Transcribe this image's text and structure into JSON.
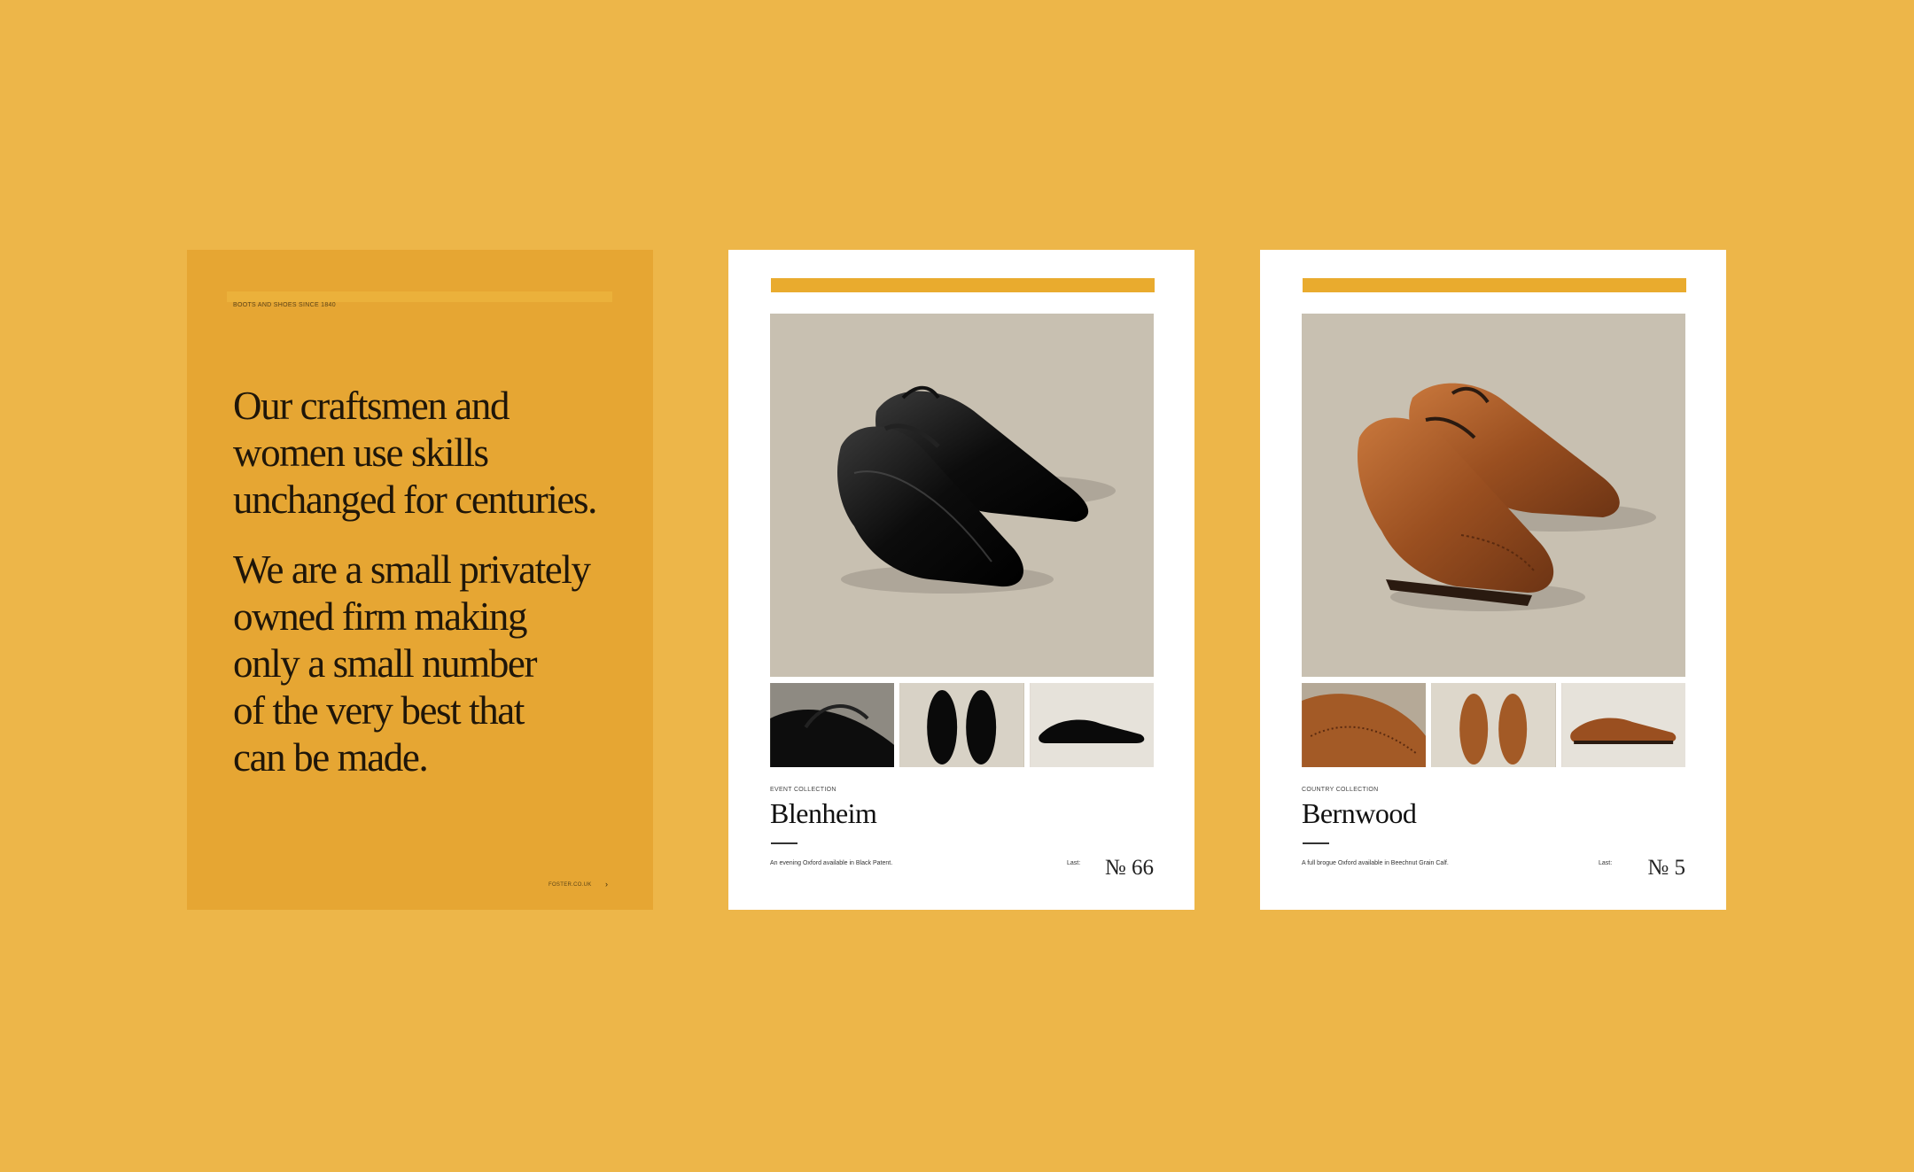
{
  "colors": {
    "background": "#EDB649",
    "intro_page": "#E6A633",
    "accent_bar": "#E9AB2E",
    "photo_backdrop": "#C8C0B1"
  },
  "intro": {
    "eyebrow": "BOOTS AND SHOES SINCE 1840",
    "paragraph_1": "Our craftsmen and\nwomen use skills\nunchanged for centuries.",
    "paragraph_2": "We are a small privately\nowned firm making\nonly a small number\nof the very best that\ncan be made.",
    "site": "FOSTER.CO.UK",
    "next_arrow": "›"
  },
  "products": [
    {
      "collection": "EVENT COLLECTION",
      "name": "Blenheim",
      "description": "An evening Oxford available in Black Patent.",
      "last_label": "Last:",
      "last_number": "№ 66",
      "shoe_color": "black"
    },
    {
      "collection": "COUNTRY COLLECTION",
      "name": "Bernwood",
      "description": "A full brogue Oxford available in Beechnut Grain Calf.",
      "last_label": "Last:",
      "last_number": "№ 5",
      "shoe_color": "tan"
    }
  ]
}
